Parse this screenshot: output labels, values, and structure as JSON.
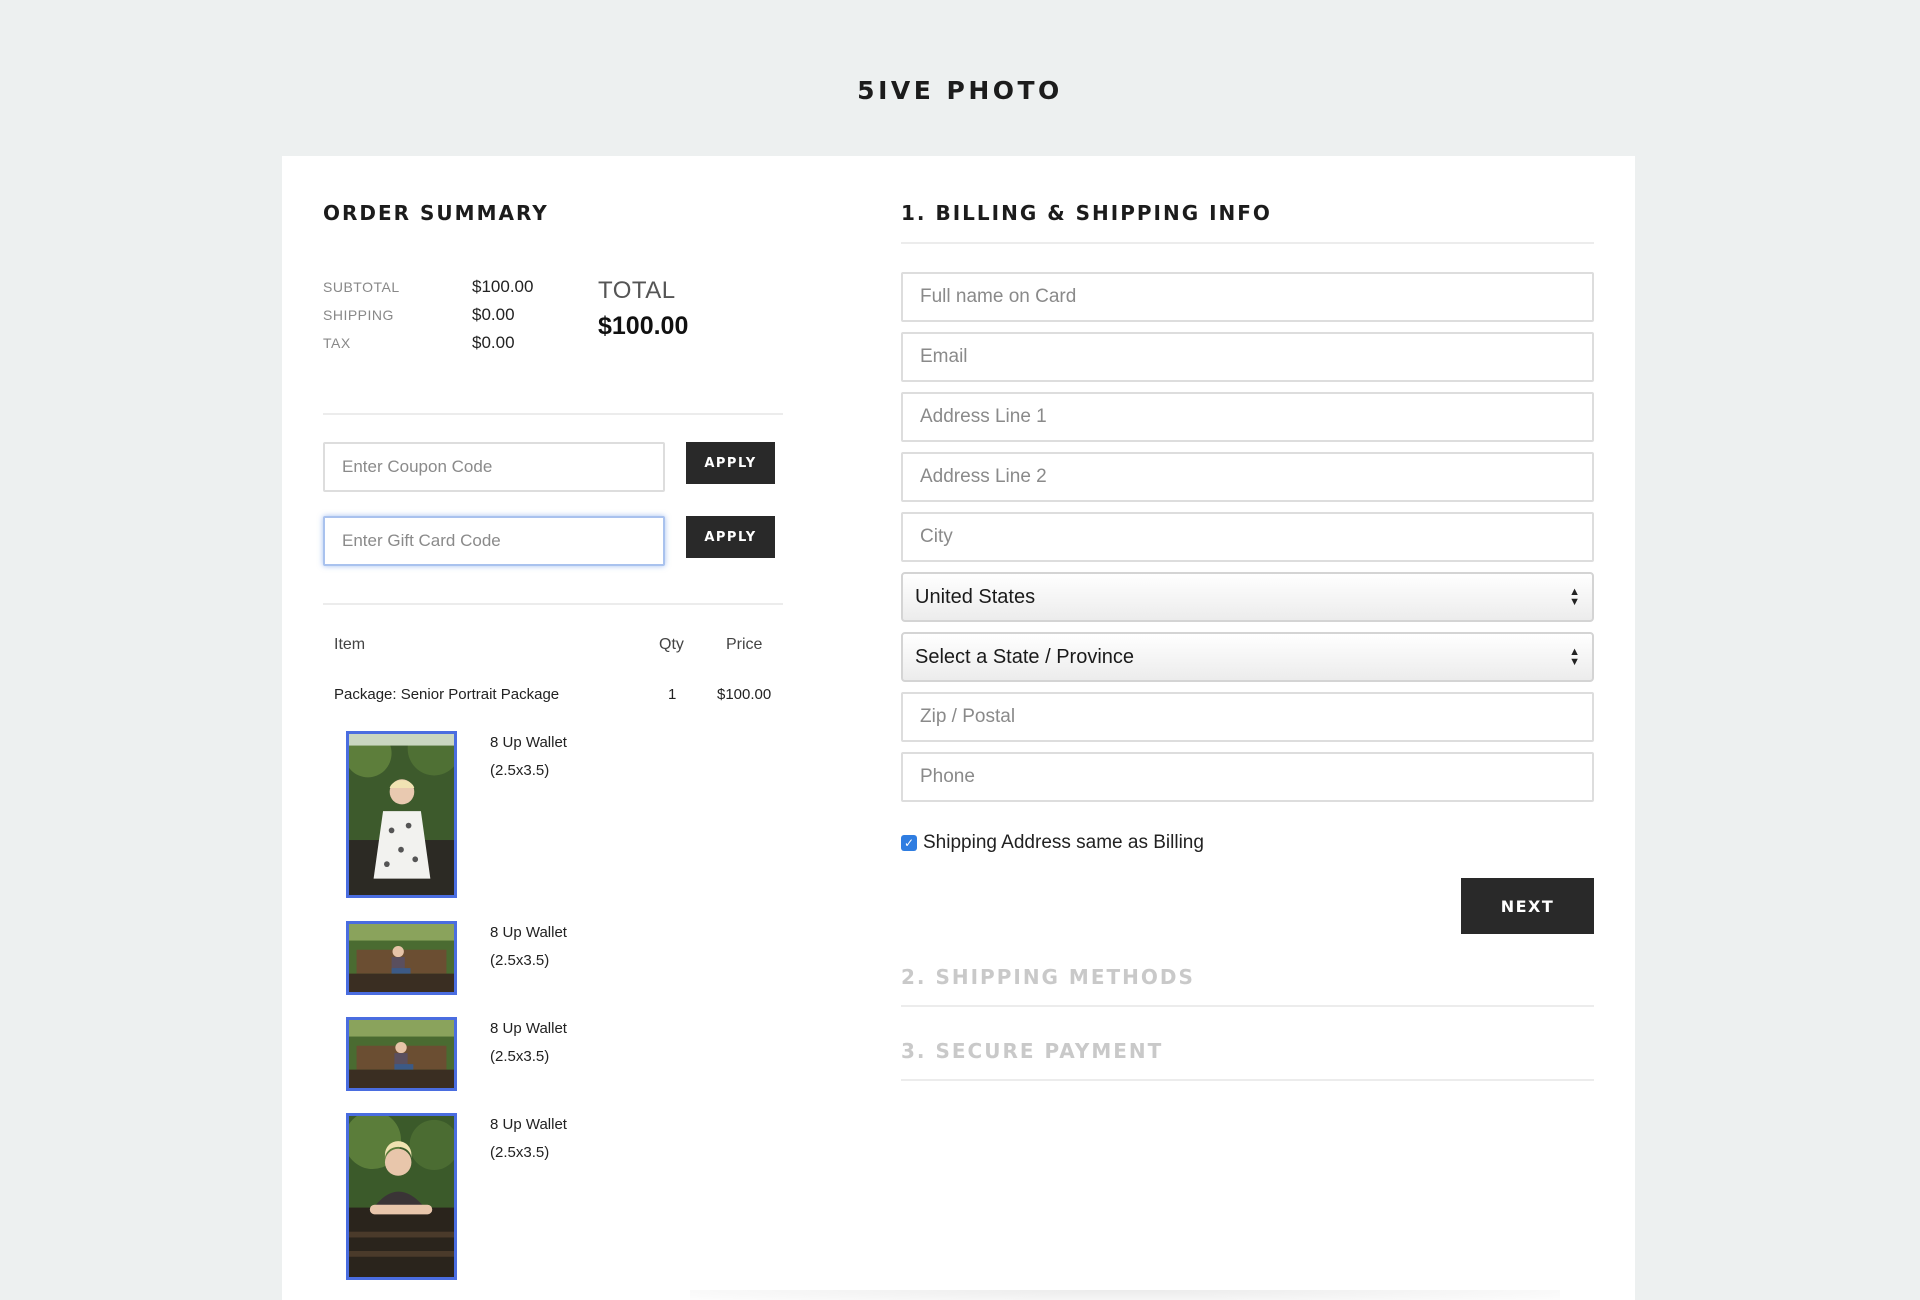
{
  "brand": "5IVE PHOTO",
  "summary": {
    "title": "ORDER SUMMARY",
    "subtotal_label": "SUBTOTAL",
    "subtotal_value": "$100.00",
    "shipping_label": "SHIPPING",
    "shipping_value": "$0.00",
    "tax_label": "TAX",
    "tax_value": "$0.00",
    "total_label": "TOTAL",
    "total_value": "$100.00",
    "coupon_placeholder": "Enter Coupon Code",
    "giftcard_placeholder": "Enter Gift Card Code",
    "apply_label": "APPLY"
  },
  "items": {
    "headers": {
      "item": "Item",
      "qty": "Qty",
      "price": "Price"
    },
    "package": {
      "name": "Package: Senior Portrait Package",
      "qty": "1",
      "price": "$100.00"
    },
    "photos": [
      {
        "line1": "8 Up Wallet",
        "line2": "(2.5x3.5)"
      },
      {
        "line1": "8 Up Wallet",
        "line2": "(2.5x3.5)"
      },
      {
        "line1": "8 Up Wallet",
        "line2": "(2.5x3.5)"
      },
      {
        "line1": "8 Up Wallet",
        "line2": "(2.5x3.5)"
      }
    ]
  },
  "billing": {
    "title": "1. BILLING & SHIPPING INFO",
    "full_name_placeholder": "Full name on Card",
    "email_placeholder": "Email",
    "address1_placeholder": "Address Line 1",
    "address2_placeholder": "Address Line 2",
    "city_placeholder": "City",
    "country_selected": "United States",
    "state_selected": "Select a State / Province",
    "zip_placeholder": "Zip / Postal",
    "phone_placeholder": "Phone",
    "same_address_label": "Shipping Address same as Billing",
    "same_address_checked": true,
    "next_label": "NEXT"
  },
  "steps": {
    "shipping_methods": "2. SHIPPING METHODS",
    "secure_payment": "3. SECURE PAYMENT"
  },
  "colors": {
    "background": "#edf0f0",
    "button_dark": "#292929",
    "thumb_border": "#4a6de0",
    "checkbox": "#2f7de1",
    "muted_step": "#c9c9c9"
  }
}
